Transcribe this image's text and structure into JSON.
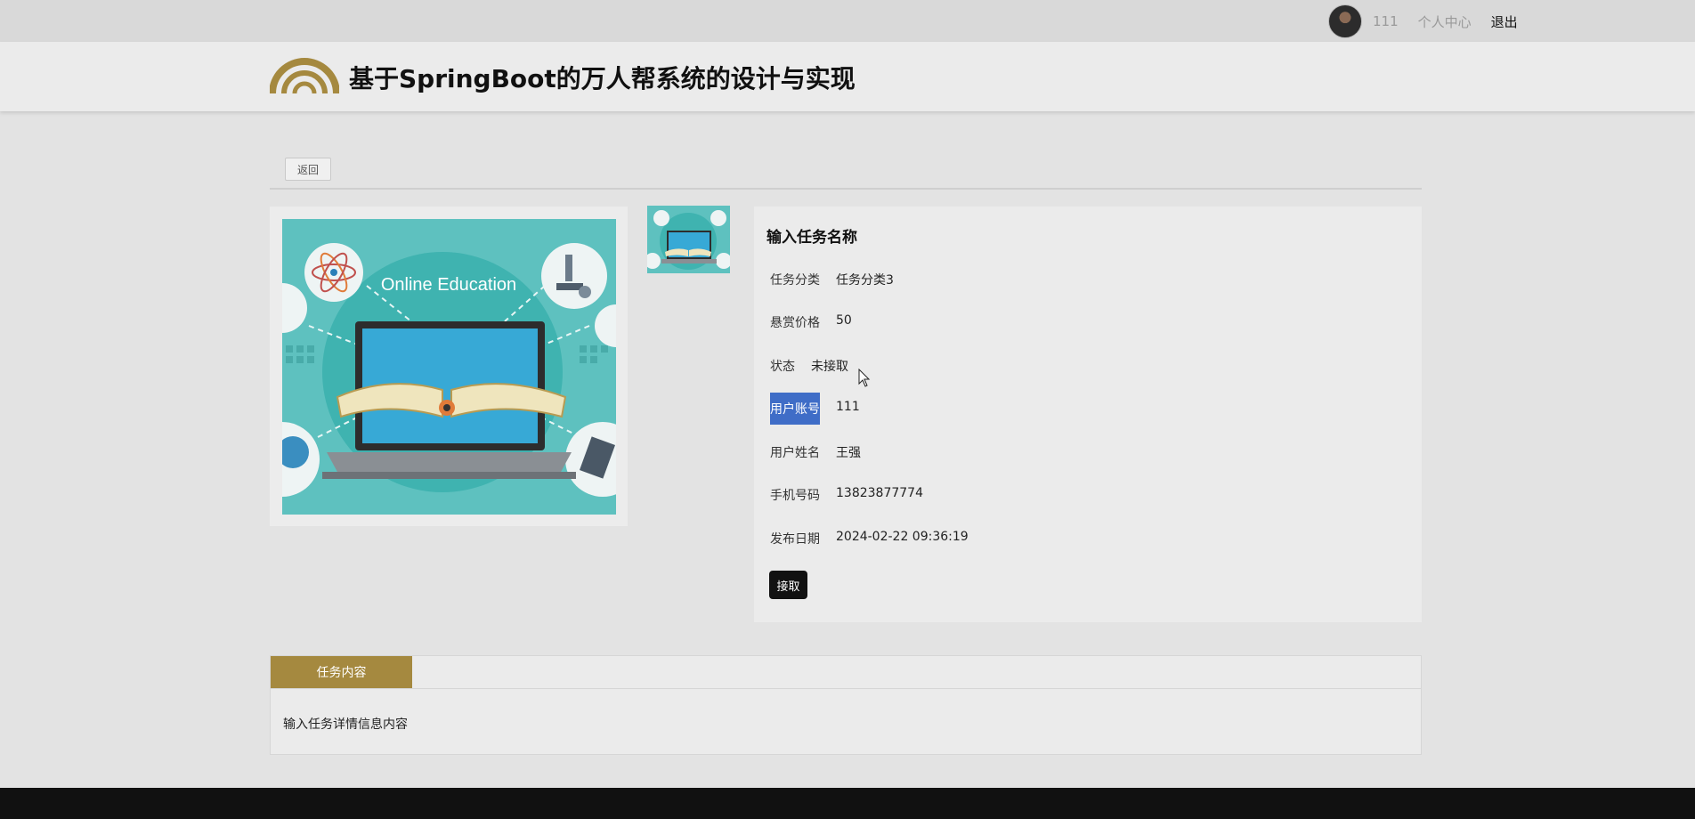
{
  "topbar": {
    "username": "111",
    "personal_center": "个人中心",
    "logout": "退出"
  },
  "header": {
    "title": "基于SpringBoot的万人帮系统的设计与实现",
    "logo_color": "#a5893f"
  },
  "nav": {
    "back_label": "返回"
  },
  "images": {
    "main_image_text": "Online Education"
  },
  "task": {
    "name": "输入任务名称",
    "fields": [
      {
        "label": "任务分类",
        "value": "任务分类3"
      },
      {
        "label": "悬赏价格",
        "value": "50"
      },
      {
        "label": "状态",
        "value": "未接取"
      },
      {
        "label": "用户账号",
        "value": "111"
      },
      {
        "label": "用户姓名",
        "value": "王强"
      },
      {
        "label": "手机号码",
        "value": "13823877774"
      },
      {
        "label": "发布日期",
        "value": "2024-02-22 09:36:19"
      }
    ],
    "accept_label": "接取"
  },
  "content": {
    "tab_label": "任务内容",
    "text": "输入任务详情信息内容"
  },
  "colors": {
    "accent": "#a5893f",
    "button_dark": "#111111",
    "selection": "#3f6dc7"
  }
}
